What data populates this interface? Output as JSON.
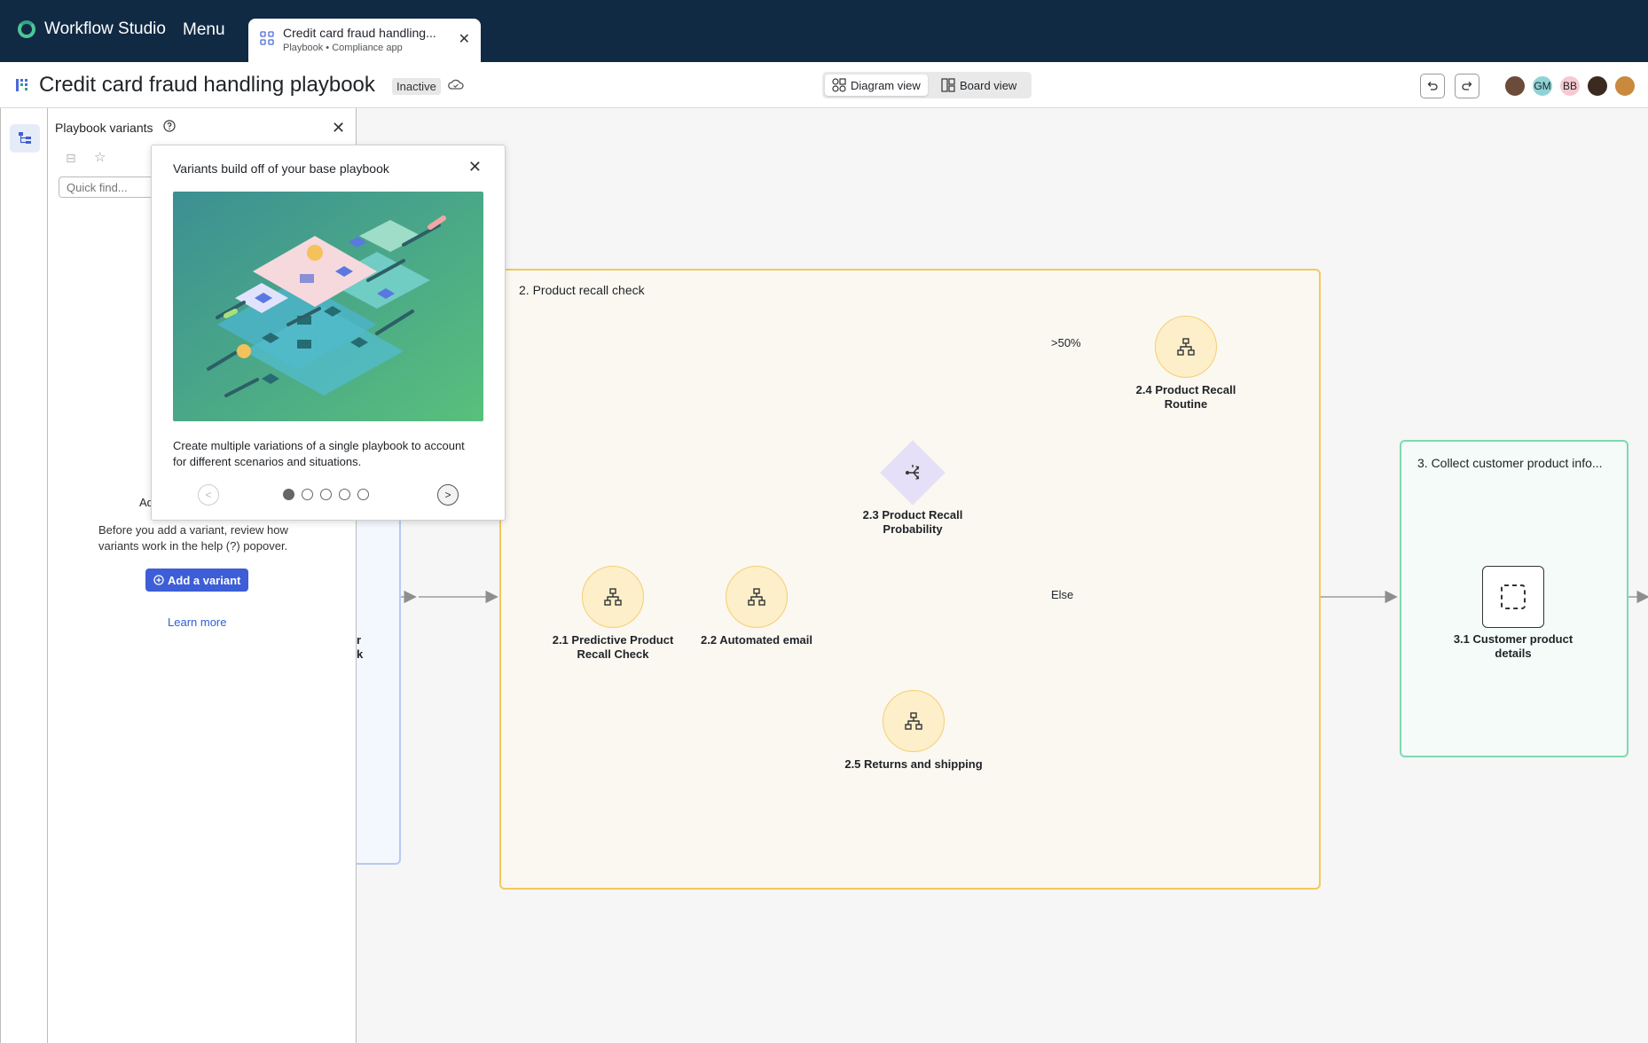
{
  "app": {
    "name": "Workflow Studio",
    "menu_label": "Menu"
  },
  "tab": {
    "title": "Credit card fraud handling...",
    "subtitle": "Playbook • Compliance app"
  },
  "header": {
    "title": "Credit card fraud handling playbook",
    "status": "Inactive",
    "views": {
      "diagram": "Diagram view",
      "board": "Board view"
    },
    "avatars": [
      {
        "initials": "",
        "color": "#6b4b3a"
      },
      {
        "initials": "GM",
        "color": "#8fd3d6"
      },
      {
        "initials": "BB",
        "color": "#f6c9d0"
      },
      {
        "initials": "",
        "color": "#3b2a20"
      },
      {
        "initials": "",
        "color": "#c98a3e"
      }
    ]
  },
  "variants_panel": {
    "title": "Playbook variants",
    "search_placeholder": "Quick find...",
    "empty_title": "Ad",
    "empty_desc": "Before you add a variant, review how variants work in the help (?) popover.",
    "add_button": "Add a variant",
    "learn_more": "Learn more"
  },
  "popover": {
    "title": "Variants build off of your base playbook",
    "text": "Create multiple variations of a single playbook to account for different scenarios and situations.",
    "pages": 5,
    "current_page": 1
  },
  "canvas": {
    "prev_group_cut": [
      "r",
      "k"
    ],
    "group_recall": {
      "label": "2. Product recall check",
      "nodes": [
        {
          "id": "2.1",
          "label": "2.1 Predictive Product Recall Check"
        },
        {
          "id": "2.2",
          "label": "2.2 Automated email"
        },
        {
          "id": "2.3",
          "label": "2.3 Product Recall Probability"
        },
        {
          "id": "2.4",
          "label": "2.4 Product Recall Routine"
        },
        {
          "id": "2.5",
          "label": "2.5 Returns and shipping"
        }
      ],
      "edge_labels": {
        "high": ">50%",
        "else": "Else"
      }
    },
    "group_collect": {
      "label": "3. Collect customer product info...",
      "nodes": [
        {
          "id": "3.1",
          "label": "3.1 Customer product details"
        }
      ]
    }
  },
  "colors": {
    "topbar": "#112a44",
    "accent": "#3d5ed6",
    "recall_group_border": "#f4c85c",
    "collect_group_border": "#7fd8b1"
  }
}
